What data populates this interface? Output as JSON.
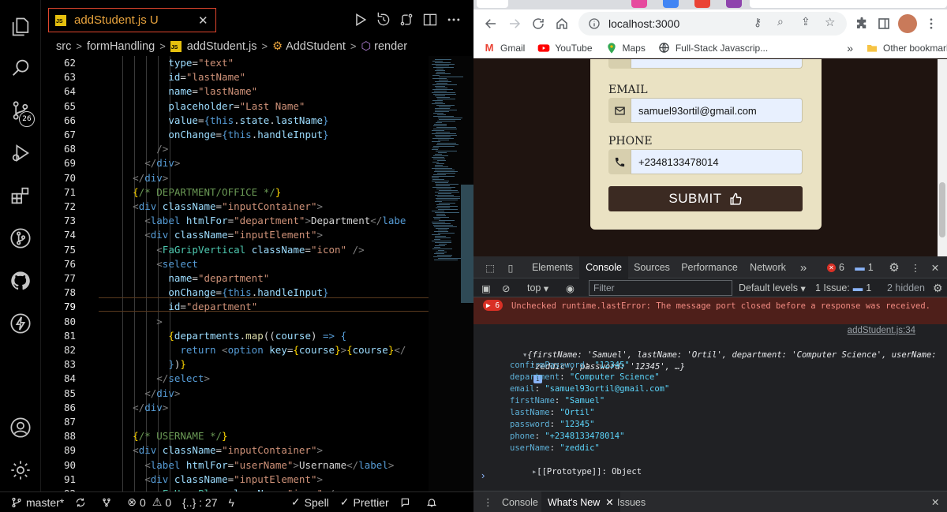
{
  "editor": {
    "tab_label": "addStudent.js",
    "tab_status": "U",
    "tab_file_badge": "JS",
    "breadcrumbs": [
      "src",
      "formHandling",
      "addStudent.js",
      "AddStudent",
      "render"
    ],
    "breadcrumb_js_badge": "JS",
    "badge_count": "26",
    "active_line": "79",
    "lines": [
      {
        "n": "62",
        "html": "            <span class='a'>type</span>=<span class='s'>\"text\"</span>"
      },
      {
        "n": "63",
        "html": "            <span class='a'>id</span>=<span class='s'>\"lastName\"</span>"
      },
      {
        "n": "64",
        "html": "            <span class='a'>name</span>=<span class='s'>\"lastName\"</span>"
      },
      {
        "n": "65",
        "html": "            <span class='a'>placeholder</span>=<span class='s'>\"Last Name\"</span>"
      },
      {
        "n": "66",
        "html": "            <span class='a'>value</span>=<span class='k'>{</span><span class='k'>this</span>.<span class='a'>state</span>.<span class='a'>lastName</span><span class='k'>}</span>"
      },
      {
        "n": "67",
        "html": "            <span class='a'>onChange</span>=<span class='k'>{</span><span class='k'>this</span>.<span class='a'>handleInput</span><span class='k'>}</span>"
      },
      {
        "n": "68",
        "html": "          <span class='p'>/></span>"
      },
      {
        "n": "69",
        "html": "        <span class='p'>&lt;/</span><span class='k'>div</span><span class='p'>></span>"
      },
      {
        "n": "70",
        "html": "      <span class='p'>&lt;/</span><span class='k'>div</span><span class='p'>></span>"
      },
      {
        "n": "71",
        "html": "      <span class='b'>{</span><span class='c'>/* DEPARTMENT/OFFICE */</span><span class='b'>}</span>"
      },
      {
        "n": "72",
        "html": "      <span class='p'>&lt;</span><span class='k'>div</span> <span class='a'>className</span>=<span class='s'>\"inputContainer\"</span><span class='p'>></span>"
      },
      {
        "n": "73",
        "html": "        <span class='p'>&lt;</span><span class='k'>label</span> <span class='a'>htmlFor</span>=<span class='s'>\"department\"</span><span class='p'>></span>Department<span class='p'>&lt;/</span><span class='k'>labe</span>"
      },
      {
        "n": "74",
        "html": "        <span class='p'>&lt;</span><span class='k'>div</span> <span class='a'>className</span>=<span class='s'>\"inputElement\"</span><span class='p'>></span>"
      },
      {
        "n": "75",
        "html": "          <span class='p'>&lt;</span><span class='t'>FaGripVertical</span> <span class='a'>className</span>=<span class='s'>\"icon\"</span> <span class='p'>/></span>"
      },
      {
        "n": "76",
        "html": "          <span class='p'>&lt;</span><span class='k'>select</span>"
      },
      {
        "n": "77",
        "html": "            <span class='a'>name</span>=<span class='s'>\"department\"</span>"
      },
      {
        "n": "78",
        "html": "            <span class='a'>onChange</span>=<span class='k'>{</span><span class='k'>this</span>.<span class='a'>handleInput</span><span class='k'>}</span>"
      },
      {
        "n": "79",
        "html": "            <span class='a'>id</span>=<span class='s'>\"department\"</span>"
      },
      {
        "n": "80",
        "html": "          <span class='p'>></span>"
      },
      {
        "n": "81",
        "html": "            <span class='b'>{</span><span class='a'>departments</span>.<span class='f'>map</span>((<span class='a'>course</span>) <span class='k'>=></span> <span class='k'>{</span>"
      },
      {
        "n": "82",
        "html": "              <span class='k'>return</span> <span class='p'>&lt;</span><span class='k'>option</span> <span class='a'>key</span>=<span class='b'>{</span><span class='a'>course</span><span class='b'>}</span><span class='p'>></span><span class='b'>{</span><span class='a'>course</span><span class='b'>}</span><span class='p'>&lt;/</span>"
      },
      {
        "n": "83",
        "html": "            <span class='k'>}</span>)<span class='b'>}</span>"
      },
      {
        "n": "84",
        "html": "          <span class='p'>&lt;/</span><span class='k'>select</span><span class='p'>></span>"
      },
      {
        "n": "85",
        "html": "        <span class='p'>&lt;/</span><span class='k'>div</span><span class='p'>></span>"
      },
      {
        "n": "86",
        "html": "      <span class='p'>&lt;/</span><span class='k'>div</span><span class='p'>></span>"
      },
      {
        "n": "87",
        "html": ""
      },
      {
        "n": "88",
        "html": "      <span class='b'>{</span><span class='c'>/* USERNAME */</span><span class='b'>}</span>"
      },
      {
        "n": "89",
        "html": "      <span class='p'>&lt;</span><span class='k'>div</span> <span class='a'>className</span>=<span class='s'>\"inputContainer\"</span><span class='p'>></span>"
      },
      {
        "n": "90",
        "html": "        <span class='p'>&lt;</span><span class='k'>label</span> <span class='a'>htmlFor</span>=<span class='s'>\"userName\"</span><span class='p'>></span>Username<span class='p'>&lt;/</span><span class='k'>label</span><span class='p'>></span>"
      },
      {
        "n": "91",
        "html": "        <span class='p'>&lt;</span><span class='k'>div</span> <span class='a'>className</span>=<span class='s'>\"inputElement\"</span><span class='p'>></span>"
      },
      {
        "n": "92",
        "html": "          <span class='p'>&lt;</span><span class='t'>FaUserPlus</span> <span class='a'>className</span>=<span class='s'>\"icon\"</span> <span class='p'>/></span>"
      }
    ],
    "status": {
      "branch": "master*",
      "errors": "0",
      "warnings": "0",
      "selection": "{..} : 27",
      "spell": "Spell",
      "prettier": "Prettier"
    }
  },
  "browser": {
    "url": "localhost:3000",
    "bookmarks": [
      "Gmail",
      "YouTube",
      "Maps",
      "Full-Stack Javascrip..."
    ],
    "bookmarks_more": "»",
    "other_bookmarks": "Other bookmarks",
    "form": {
      "email_label": "EMAIL",
      "email_value": "samuel93ortil@gmail.com",
      "phone_label": "PHONE",
      "phone_value": "+2348133478014",
      "submit_label": "SUBMIT"
    },
    "colors": {
      "accent": "#3b2a22",
      "card": "#eae2c3",
      "page_bg": "#1f1410"
    }
  },
  "devtools": {
    "tabs": [
      "Elements",
      "Console",
      "Sources",
      "Performance",
      "Network"
    ],
    "tabs_more": "»",
    "error_badge": "6",
    "msg_badge": "1",
    "context": "top",
    "filter_placeholder": "Filter",
    "levels": "Default levels",
    "issues_label": "1 Issue:",
    "issues_count": "1",
    "hidden": "2 hidden",
    "error_count": "6",
    "error_text": "Unchecked runtime.lastError: The message port closed before a response was received.",
    "log_source": "addStudent.js:34",
    "log_summary_1": "{firstName: 'Samuel', lastName: 'Ortil', department: 'Computer Science', userName:",
    "log_summary_2": "'zeddic', password: '12345', …}",
    "log_info_icon": "i",
    "props": [
      {
        "key": "confirmPassword",
        "value": "\"12345\""
      },
      {
        "key": "department",
        "value": "\"Computer Science\""
      },
      {
        "key": "email",
        "value": "\"samuel93ortil@gmail.com\""
      },
      {
        "key": "firstName",
        "value": "\"Samuel\""
      },
      {
        "key": "lastName",
        "value": "\"Ortil\""
      },
      {
        "key": "password",
        "value": "\"12345\""
      },
      {
        "key": "phone",
        "value": "\"+2348133478014\""
      },
      {
        "key": "userName",
        "value": "\"zeddic\""
      }
    ],
    "prototype": "[[Prototype]]: Object",
    "drawer_tabs": [
      "Console",
      "What's New",
      "Issues"
    ]
  }
}
